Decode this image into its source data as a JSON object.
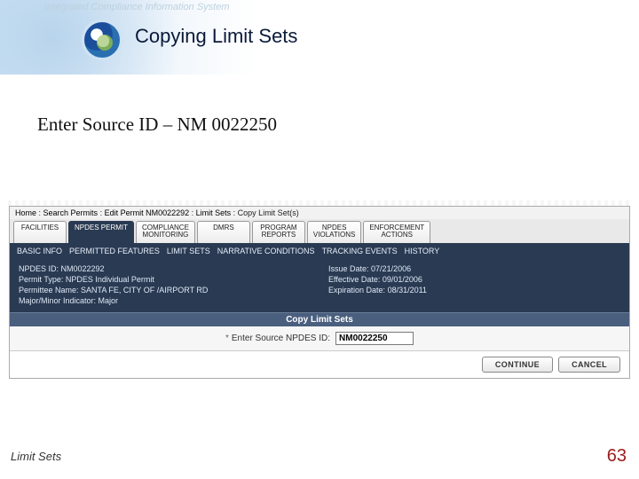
{
  "header": {
    "watermark": "Integrated Compliance Information System",
    "title": "Copying Limit Sets"
  },
  "instruction": "Enter Source ID – NM 0022250",
  "breadcrumb": {
    "items": [
      "Home",
      "Search Permits",
      "Edit Permit NM0022292",
      "Limit Sets",
      "Copy Limit Set(s)"
    ]
  },
  "tabs_main": [
    {
      "label": "FACILITIES"
    },
    {
      "label": "NPDES PERMIT"
    },
    {
      "label": "COMPLIANCE\nMONITORING"
    },
    {
      "label": "DMRS"
    },
    {
      "label": "PROGRAM\nREPORTS"
    },
    {
      "label": "NPDES\nVIOLATIONS"
    },
    {
      "label": "ENFORCEMENT\nACTIONS"
    }
  ],
  "tabs_sub": [
    "BASIC INFO",
    "PERMITTED FEATURES",
    "LIMIT SETS",
    "NARRATIVE CONDITIONS",
    "TRACKING EVENTS",
    "HISTORY"
  ],
  "details": {
    "npdes_id_label": "NPDES ID:",
    "npdes_id": "NM0022292",
    "issue_date_label": "Issue Date:",
    "issue_date": "07/21/2006",
    "permit_type_label": "Permit Type:",
    "permit_type": "NPDES Individual Permit",
    "effective_date_label": "Effective Date:",
    "effective_date": "09/01/2006",
    "permittee_label": "Permittee Name:",
    "permittee": "SANTA FE, CITY OF /AIRPORT RD",
    "expiration_label": "Expiration Date:",
    "expiration": "08/31/2011",
    "major_minor_label": "Major/Minor Indicator:",
    "major_minor": "Major"
  },
  "panel_title": "Copy Limit Sets",
  "form": {
    "source_label": "Enter Source NPDES ID:",
    "source_value": "NM0022250",
    "required_mark": "*"
  },
  "buttons": {
    "continue": "CONTINUE",
    "cancel": "CANCEL"
  },
  "footer": {
    "label": "Limit Sets",
    "page": "63"
  }
}
